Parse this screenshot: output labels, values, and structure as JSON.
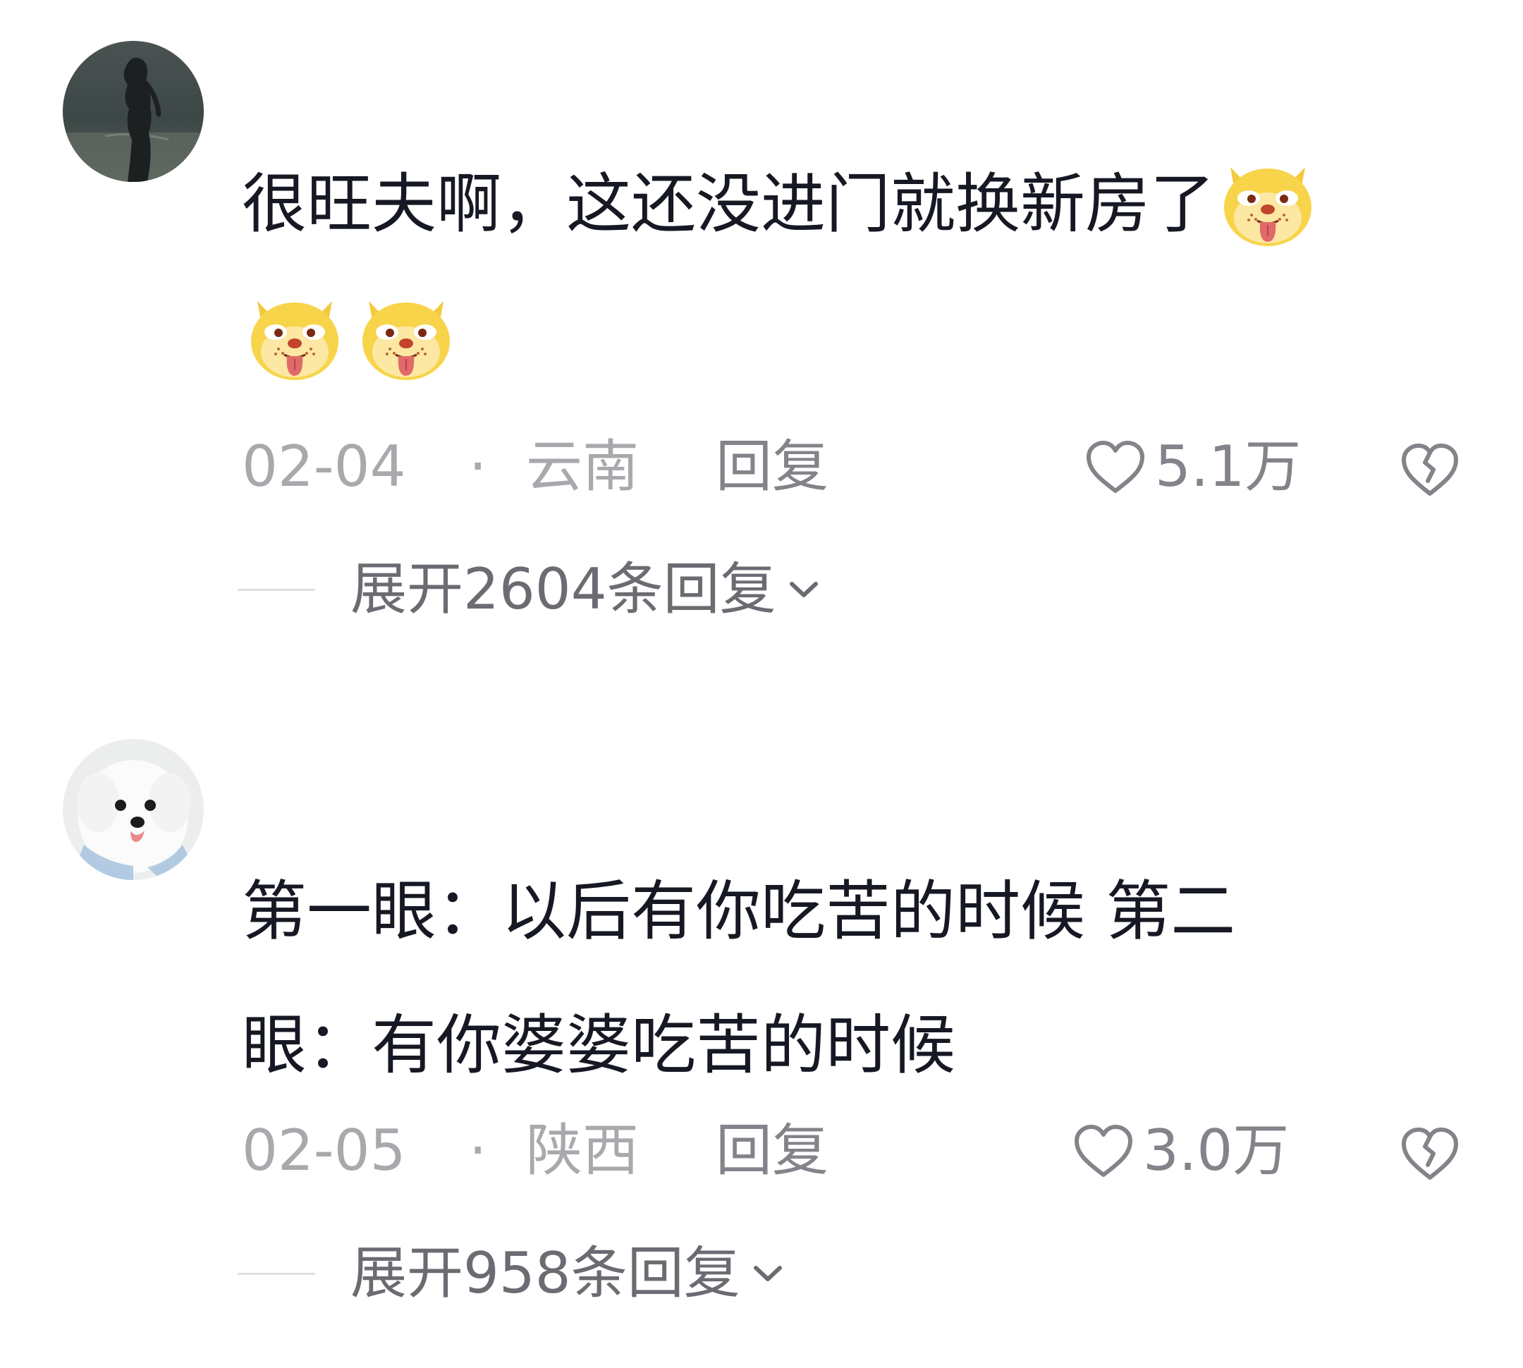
{
  "comments": [
    {
      "text": "很旺夫啊，这还没进门就换新房了",
      "emoji_icon": "doge-tongue-emoji",
      "extra_emoji_count": 2,
      "date": "02-04",
      "separator": "·",
      "region": "云南",
      "reply_label": "回复",
      "likes": "5.1万",
      "expand_label": "展开2604条回复"
    },
    {
      "text_line1": "第一眼：以后有你吃苦的时候 第二",
      "text_line2": "眼：有你婆婆吃苦的时候",
      "date": "02-05",
      "separator": "·",
      "region": "陕西",
      "reply_label": "回复",
      "likes": "3.0万",
      "expand_label": "展开958条回复"
    }
  ],
  "colors": {
    "text": "#161823",
    "meta": "#a8a9ad",
    "action": "#83848a",
    "expand": "#6b6c72"
  }
}
